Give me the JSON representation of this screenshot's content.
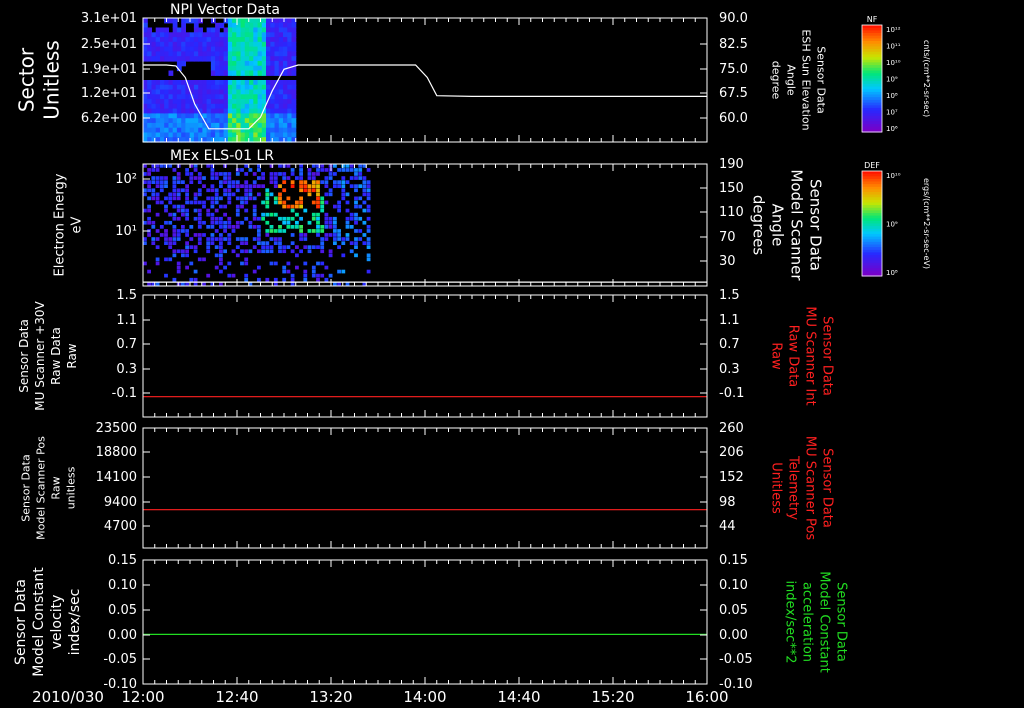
{
  "colors": {
    "background": "#000000",
    "axis": "#ffffff",
    "white_trace": "#ffffff",
    "red_trace": "#ff2020",
    "green_trace": "#22dd22",
    "red_label": "#ff2020",
    "green_label": "#22dd22"
  },
  "time_axis": {
    "date_label": "2010/030",
    "range": [
      "12:00",
      "16:00"
    ],
    "ticks": [
      "12:00",
      "12:40",
      "13:20",
      "14:00",
      "14:40",
      "15:20",
      "16:00"
    ]
  },
  "colorbars": [
    {
      "label": "NF",
      "units": "cnts/(cm**2-sr-sec)",
      "ticks": [
        "10¹²",
        "10¹¹",
        "10¹⁰",
        "10⁹",
        "10⁸",
        "10⁷",
        "10⁶"
      ]
    },
    {
      "label": "DEF",
      "units": "ergs/(cm**2-sr-sec-eV)",
      "ticks": [
        "10¹⁰",
        "10⁹",
        "10⁸"
      ]
    }
  ],
  "chart_data": [
    {
      "type": "heatmap",
      "title": "NPI Vector Data",
      "ylabel": [
        "Sector",
        "Unitless"
      ],
      "yticks": [
        "3.1e+01",
        "2.5e+01",
        "1.9e+01",
        "1.2e+01",
        "6.2e+00"
      ],
      "y2label": [
        "Sensor Data",
        "ESH Sun Elevation",
        "Angle",
        "degree"
      ],
      "y2ticks": [
        "90.0",
        "82.5",
        "75.0",
        "67.5",
        "60.0"
      ],
      "y2lim": [
        52.5,
        90.0
      ],
      "data_coverage": [
        "12:00",
        "13:05"
      ],
      "series": [
        {
          "color": "white",
          "axis": "right",
          "x": [
            "12:00",
            "12:10",
            "12:14",
            "12:18",
            "12:22",
            "12:28",
            "12:45",
            "12:50",
            "12:55",
            "13:00",
            "13:06",
            "13:30",
            "13:56",
            "14:01",
            "14:05",
            "14:20",
            "16:00"
          ],
          "y": [
            75.8,
            75.8,
            75.5,
            72.0,
            64.0,
            56.5,
            56.5,
            60.0,
            68.0,
            74.5,
            75.8,
            75.8,
            75.8,
            72.0,
            66.5,
            66.3,
            66.3
          ]
        }
      ]
    },
    {
      "type": "heatmap",
      "title": "MEx ELS-01 LR",
      "ylabel": [
        "Electron Energy",
        "eV"
      ],
      "yticks": [
        "10²",
        "10¹"
      ],
      "ylim": [
        1,
        200
      ],
      "yscale": "log",
      "y2label": [
        "Sensor Data",
        "Model Scanner",
        "Angle",
        "degrees"
      ],
      "y2ticks": [
        "190",
        "150",
        "110",
        "70",
        "30"
      ],
      "y2lim": [
        0,
        190
      ],
      "data_coverage": [
        "12:00",
        "13:37"
      ],
      "series": [
        {
          "color": "white",
          "axis": "right",
          "x": [
            "12:00",
            "16:00"
          ],
          "y": [
            6,
            6
          ]
        }
      ]
    },
    {
      "type": "line",
      "ylabel": [
        "Sensor Data",
        "MU Scanner +30V",
        "Raw Data",
        "Raw"
      ],
      "yticks": [
        "1.5",
        "1.1",
        "0.7",
        "0.3",
        "-0.1"
      ],
      "ylim": [
        -0.3,
        1.5
      ],
      "y2label": [
        "Sensor Data",
        "MU Scanner Int",
        "Raw Data",
        "Raw"
      ],
      "y2ticks": [
        "1.5",
        "1.1",
        "0.7",
        "0.3",
        "-0.1"
      ],
      "y2lim": [
        -0.3,
        1.5
      ],
      "series": [
        {
          "color": "red",
          "axis": "right",
          "x": [
            "12:00",
            "16:00"
          ],
          "y": [
            0.0,
            0.0
          ]
        }
      ]
    },
    {
      "type": "line",
      "ylabel": [
        "Sensor Data",
        "Model Scanner Pos",
        "Raw",
        "unitless"
      ],
      "yticks": [
        "23500",
        "18800",
        "14100",
        "9400",
        "4700"
      ],
      "ylim": [
        0,
        23500
      ],
      "y2label": [
        "Sensor Data",
        "MU Scanner Pos",
        "Telemetry",
        "Unitless"
      ],
      "y2ticks": [
        "260",
        "206",
        "152",
        "98",
        "44"
      ],
      "y2lim": [
        0,
        260
      ],
      "series": [
        {
          "color": "red",
          "axis": "right",
          "x": [
            "12:00",
            "16:00"
          ],
          "y": [
            83,
            83
          ]
        }
      ]
    },
    {
      "type": "line",
      "ylabel": [
        "Sensor Data",
        "Model Constant",
        "velocity",
        "index/sec"
      ],
      "yticks": [
        "0.15",
        "0.10",
        "0.05",
        "0.00",
        "-0.05",
        "-0.10"
      ],
      "ylim": [
        -0.1,
        0.15
      ],
      "y2label": [
        "Sensor Data",
        "Model Constant",
        "acceleration",
        "index/sec**2"
      ],
      "y2ticks": [
        "0.15",
        "0.10",
        "0.05",
        "0.00",
        "-0.05",
        "-0.10"
      ],
      "y2lim": [
        -0.1,
        0.15
      ],
      "series": [
        {
          "color": "green",
          "axis": "right",
          "x": [
            "12:00",
            "16:00"
          ],
          "y": [
            0.0,
            0.0
          ]
        }
      ]
    }
  ]
}
